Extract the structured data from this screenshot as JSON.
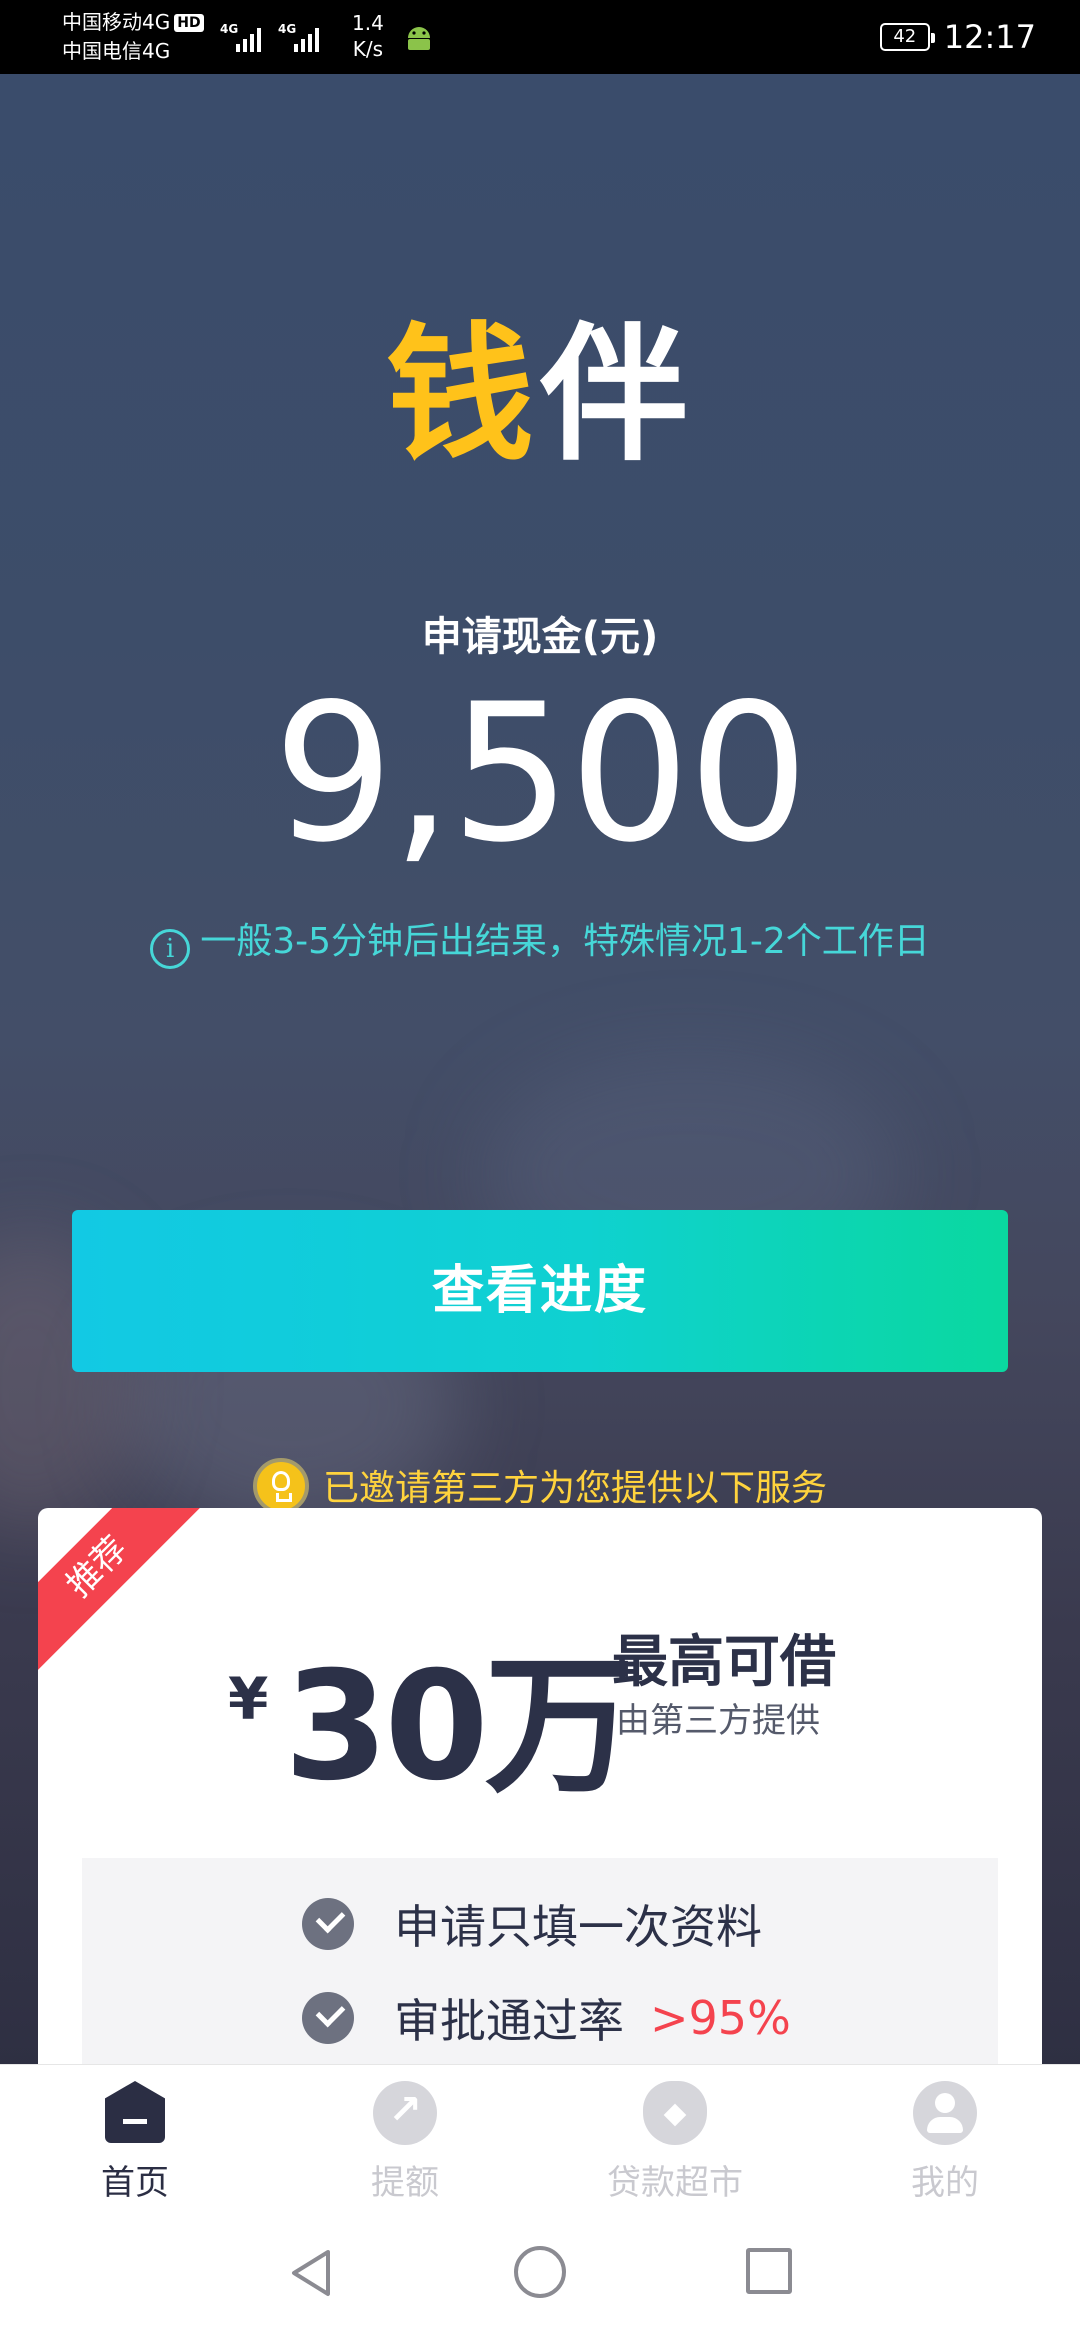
{
  "status_bar": {
    "carrier1": "中国移动4G",
    "hd_badge": "HD",
    "carrier2": "中国电信4G",
    "sim1_network": "4G",
    "sim2_network": "4G",
    "speed_value": "1.4",
    "speed_unit": "K/s",
    "battery": "42",
    "time": "12:17"
  },
  "logo": {
    "char1": "钱",
    "char2": "伴"
  },
  "application": {
    "label": "申请现金(元)",
    "amount": "9,500",
    "info_text": "一般3-5分钟后出结果，特殊情况1-2个工作日",
    "info_icon": "i"
  },
  "progress_button": {
    "label": "查看进度"
  },
  "invite": {
    "text": "已邀请第三方为您提供以下服务"
  },
  "offer_card": {
    "ribbon": "推荐",
    "currency": "¥",
    "amount": "30万",
    "label": "最高可借",
    "sub": "由第三方提供",
    "features": [
      {
        "text": "申请只填一次资料"
      },
      {
        "text": "审批通过率",
        "highlight": ">95%"
      }
    ]
  },
  "tab_bar": {
    "tabs": [
      {
        "label": "首页",
        "icon": "home-icon",
        "active": true
      },
      {
        "label": "提额",
        "icon": "trend-up-icon",
        "active": false
      },
      {
        "label": "贷款超市",
        "icon": "money-bag-icon",
        "active": false
      },
      {
        "label": "我的",
        "icon": "user-icon",
        "active": false
      }
    ]
  },
  "colors": {
    "accent_cyan": "#12c9e4",
    "accent_green": "#0ad89f",
    "info_text": "#46d7d8",
    "invite_text": "#ffd33d",
    "ribbon": "#f4434e",
    "dark_navy": "#2c3148"
  }
}
